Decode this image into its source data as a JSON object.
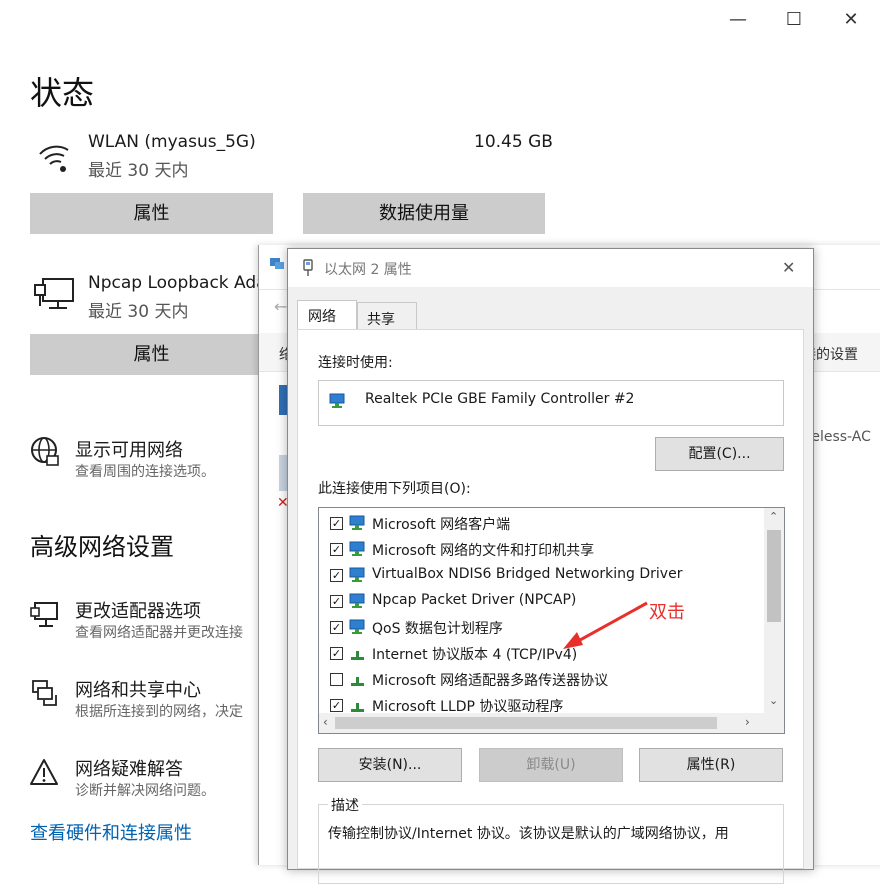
{
  "settings": {
    "window_controls": {
      "minimize": "—",
      "maximize": "☐",
      "close": "✕"
    },
    "status_title": "状态",
    "wlan": {
      "name": "WLAN (myasus_5G)",
      "period": "最近 30 天内",
      "usage": "10.45 GB"
    },
    "wlan_buttons": {
      "properties": "属性",
      "data_usage": "数据使用量"
    },
    "npcap": {
      "name": "Npcap Loopback Ada",
      "period": "最近 30 天内"
    },
    "npcap_buttons": {
      "properties": "属性"
    },
    "show_networks": {
      "title": "显示可用网络",
      "desc": "查看周围的连接选项。"
    },
    "advanced_title": "高级网络设置",
    "adapter_options": {
      "title": "更改适配器选项",
      "desc": "查看网络适配器并更改连接"
    },
    "sharing_center": {
      "title": "网络和共享中心",
      "desc": "根据所连接到的网络，决定"
    },
    "troubleshoot": {
      "title": "网络疑难解答",
      "desc": "诊断并解决网络问题。"
    },
    "hardware_link": "查看硬件和连接属性"
  },
  "background_window": {
    "partial_left": "络",
    "partial_right_settings": "接的设置",
    "partial_right_wireless": "ireless-AC"
  },
  "dialog": {
    "title": "以太网 2 属性",
    "close": "✕",
    "tabs": [
      "网络",
      "共享"
    ],
    "connect_using_label": "连接时使用:",
    "adapter_name": "Realtek PCIe GBE Family Controller #2",
    "configure_button": "配置(C)...",
    "items_label": "此连接使用下列项目(O):",
    "items": [
      {
        "label": "Microsoft 网络客户端",
        "checked": true
      },
      {
        "label": "Microsoft 网络的文件和打印机共享",
        "checked": true
      },
      {
        "label": "VirtualBox NDIS6 Bridged Networking Driver",
        "checked": true
      },
      {
        "label": "Npcap Packet Driver (NPCAP)",
        "checked": true
      },
      {
        "label": "QoS 数据包计划程序",
        "checked": true
      },
      {
        "label": "Internet 协议版本 4 (TCP/IPv4)",
        "checked": true
      },
      {
        "label": "Microsoft 网络适配器多路传送器协议",
        "checked": false
      },
      {
        "label": "Microsoft LLDP 协议驱动程序",
        "checked": true
      }
    ],
    "install_button": "安装(N)...",
    "uninstall_button": "卸载(U)",
    "properties_button": "属性(R)",
    "description_label": "描述",
    "description_text": "传输控制协议/Internet 协议。该协议是默认的广域网络协议，用"
  },
  "annotation": {
    "text": "双击",
    "color": "#e8302b"
  },
  "colors": {
    "accent": "#0063b1",
    "settings_button": "#cccccc",
    "dialog_bg": "#f0f0f0"
  }
}
